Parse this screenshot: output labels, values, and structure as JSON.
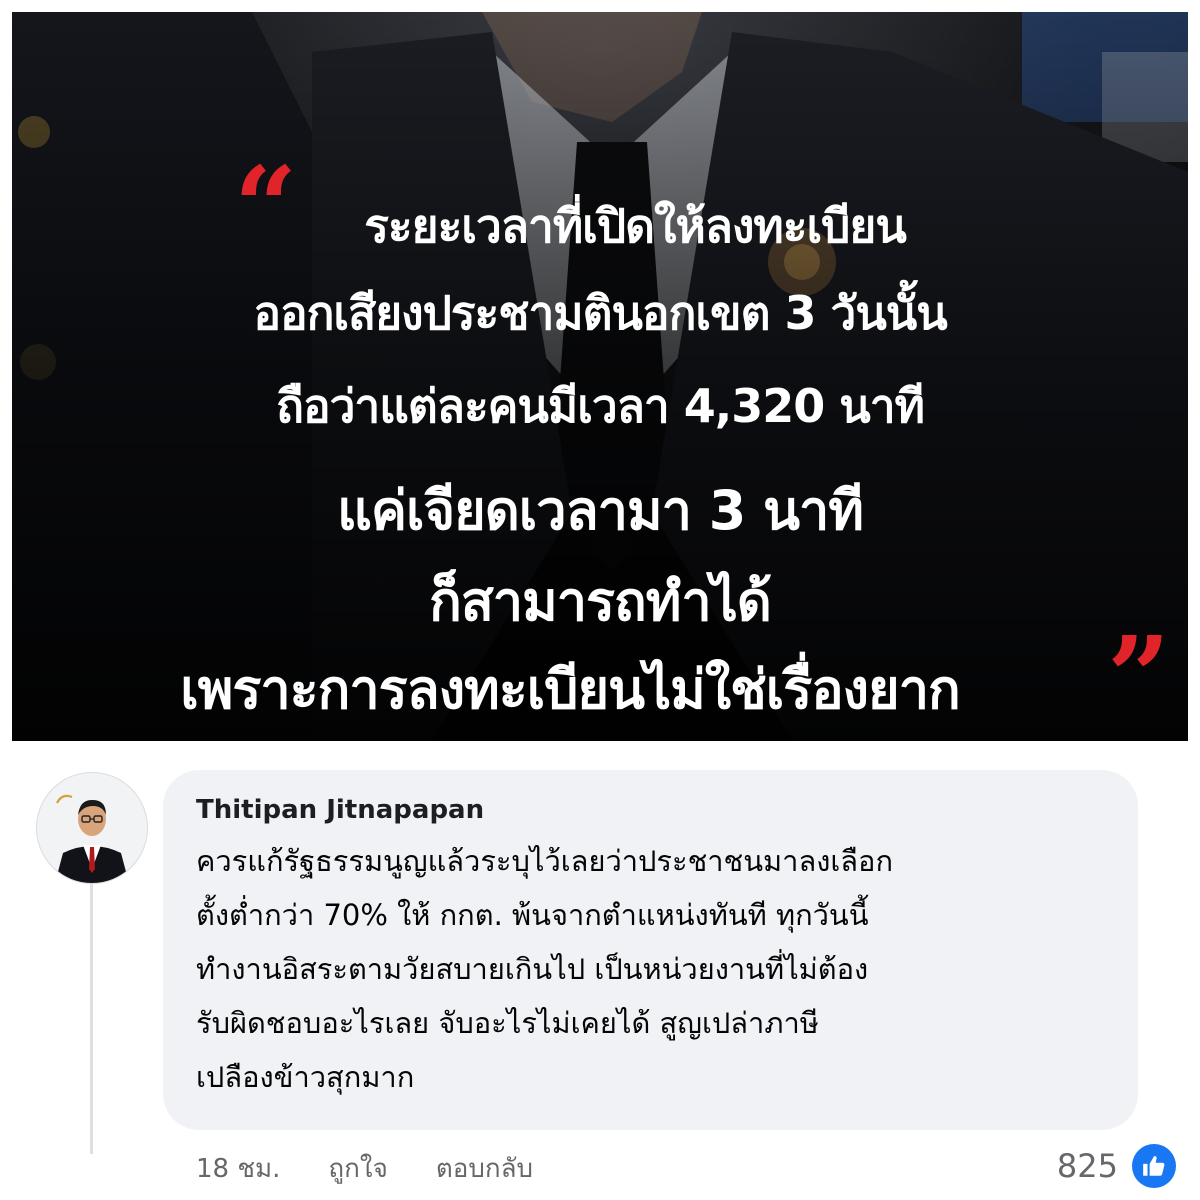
{
  "quote_image": {
    "lines": [
      "ระยะเวลาที่เปิดให้ลงทะเบียน",
      "ออกเสียงประชามตินอกเขต 3 วันนั้น",
      "ถือว่าแต่ละคนมีเวลา 4,320 นาที",
      "แค่เจียดเวลามา 3 นาที",
      "ก็สามารถทำได้",
      "เพราะการลงทะเบียนไม่ใช่เรื่องยาก"
    ],
    "open_quote": "“",
    "close_quote": "”",
    "accent_color": "#e0242a",
    "text_color": "#ffffff",
    "background_color": "#0b0b0c"
  },
  "comment": {
    "author": "Thitipan Jitnapapan",
    "avatar_icon": "profile-avatar",
    "text_lines": [
      "ควรแก้รัฐธรรมนูญแล้วระบุไว้เลยว่าประชาชนมาลงเลือก",
      "ตั้งต่ำกว่า 70% ให้ กกต. พ้นจากตำแหน่งทันที ทุกวันนี้",
      "ทำงานอิสระตามวัยสบายเกินไป เป็นหน่วยงานที่ไม่ต้อง",
      "รับผิดชอบอะไรเลย จับอะไรไม่เคยได้ สูญเปล่าภาษี",
      "เปลืองข้าวสุกมาก"
    ],
    "bubble_color": "#f0f2f5"
  },
  "actions": {
    "timestamp": "18 ชม.",
    "like_label": "ถูกใจ",
    "reply_label": "ตอบกลับ",
    "reaction_count": "825",
    "reaction_icon": "thumbs-up-icon",
    "reaction_color": "#1877f2"
  }
}
